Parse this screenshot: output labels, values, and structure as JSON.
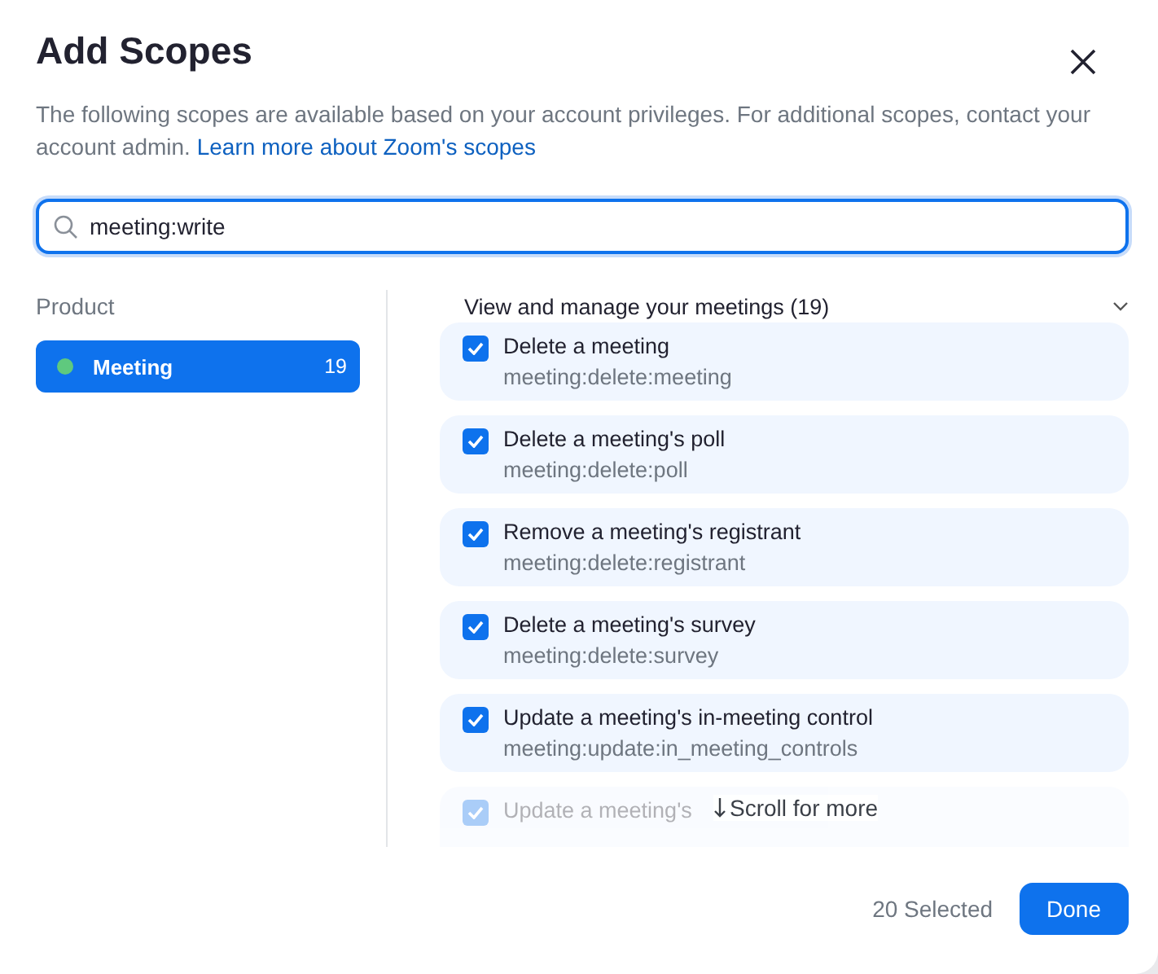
{
  "dialog": {
    "title": "Add Scopes",
    "description": "The following scopes are available based on your account privileges. For additional scopes, contact your account admin.",
    "link": "Learn more about Zoom's scopes"
  },
  "search": {
    "value": "meeting:write"
  },
  "products": {
    "heading": "Product",
    "items": [
      {
        "label": "Meeting",
        "count": "19",
        "color": "#5fc97e",
        "selected": true
      }
    ]
  },
  "group": {
    "title": "View and manage your meetings (19)",
    "expanded": true
  },
  "scopes": [
    {
      "title": "Delete a meeting",
      "scope": "meeting:delete:meeting",
      "checked": true,
      "faded": false
    },
    {
      "title": "Delete a meeting's poll",
      "scope": "meeting:delete:poll",
      "checked": true,
      "faded": false
    },
    {
      "title": "Remove a meeting's registrant",
      "scope": "meeting:delete:registrant",
      "checked": true,
      "faded": false
    },
    {
      "title": "Delete a meeting's survey",
      "scope": "meeting:delete:survey",
      "checked": true,
      "faded": false
    },
    {
      "title": "Update a meeting's in-meeting control",
      "scope": "meeting:update:in_meeting_controls",
      "checked": true,
      "faded": false
    },
    {
      "title": "Update a meeting's",
      "checked": true,
      "faded": true
    }
  ],
  "scroll_hint": "Scroll for more",
  "footer": {
    "selected_count": "20 Selected",
    "done": "Done"
  }
}
